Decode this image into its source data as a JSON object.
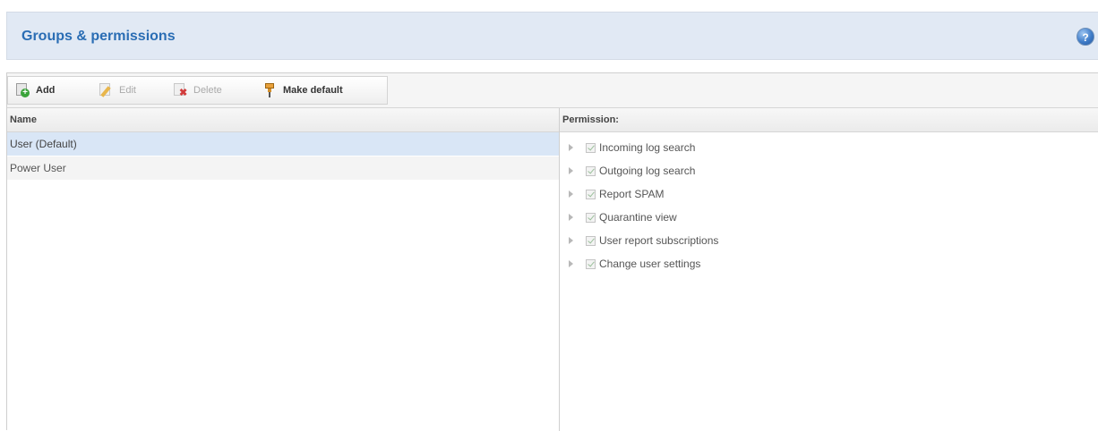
{
  "header": {
    "title": "Groups & permissions",
    "help_icon": "help-icon"
  },
  "toolbar": {
    "add_label": "Add",
    "edit_label": "Edit",
    "delete_label": "Delete",
    "make_default_label": "Make default"
  },
  "groups": {
    "column_header": "Name",
    "rows": [
      "User (Default)",
      "Power User"
    ],
    "selected_index": 0
  },
  "permissions": {
    "column_header": "Permission:",
    "items": [
      "Incoming log search",
      "Outgoing log search",
      "Report SPAM",
      "Quarantine view",
      "User report subscriptions",
      "Change user settings"
    ]
  },
  "colors": {
    "header_bg": "#e1e9f4",
    "title": "#2a6db4",
    "selected_row": "#d9e6f6"
  }
}
